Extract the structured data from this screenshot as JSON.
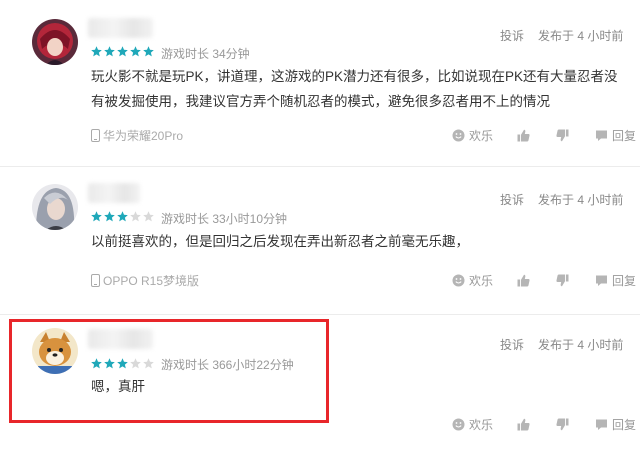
{
  "reviews": [
    {
      "rating": 5,
      "playtime": "游戏时长 34分钟",
      "report": "投诉",
      "posted": "发布于 4 小时前",
      "content": "玩火影不就是玩PK，讲道理，这游戏的PK潜力还有很多，比如说现在PK还有大量忍者没有被发掘使用，我建议官方弄个随机忍者的模式，避免很多忍者用不上的情况",
      "device": "华为荣耀20Pro",
      "funny_label": "欢乐",
      "reply_label": "回复",
      "avatar_icon": "red-hair-anime-avatar"
    },
    {
      "rating": 3,
      "playtime": "游戏时长 33小时10分钟",
      "report": "投诉",
      "posted": "发布于 4 小时前",
      "content": "以前挺喜欢的，但是回归之后发现在弄出新忍者之前毫无乐趣，",
      "device": "OPPO R15梦境版",
      "funny_label": "欢乐",
      "reply_label": "回复",
      "avatar_icon": "silver-hair-anime-avatar"
    },
    {
      "rating": 3,
      "playtime": "游戏时长 366小时22分钟",
      "report": "投诉",
      "posted": "发布于 4 小时前",
      "content": "嗯，真肝",
      "device": "",
      "funny_label": "欢乐",
      "reply_label": "回复",
      "avatar_icon": "shiba-dog-avatar"
    }
  ],
  "colors": {
    "star_filled": "#1fa8b9",
    "star_empty": "#d9d9d9",
    "highlight_border": "#e8262a"
  }
}
